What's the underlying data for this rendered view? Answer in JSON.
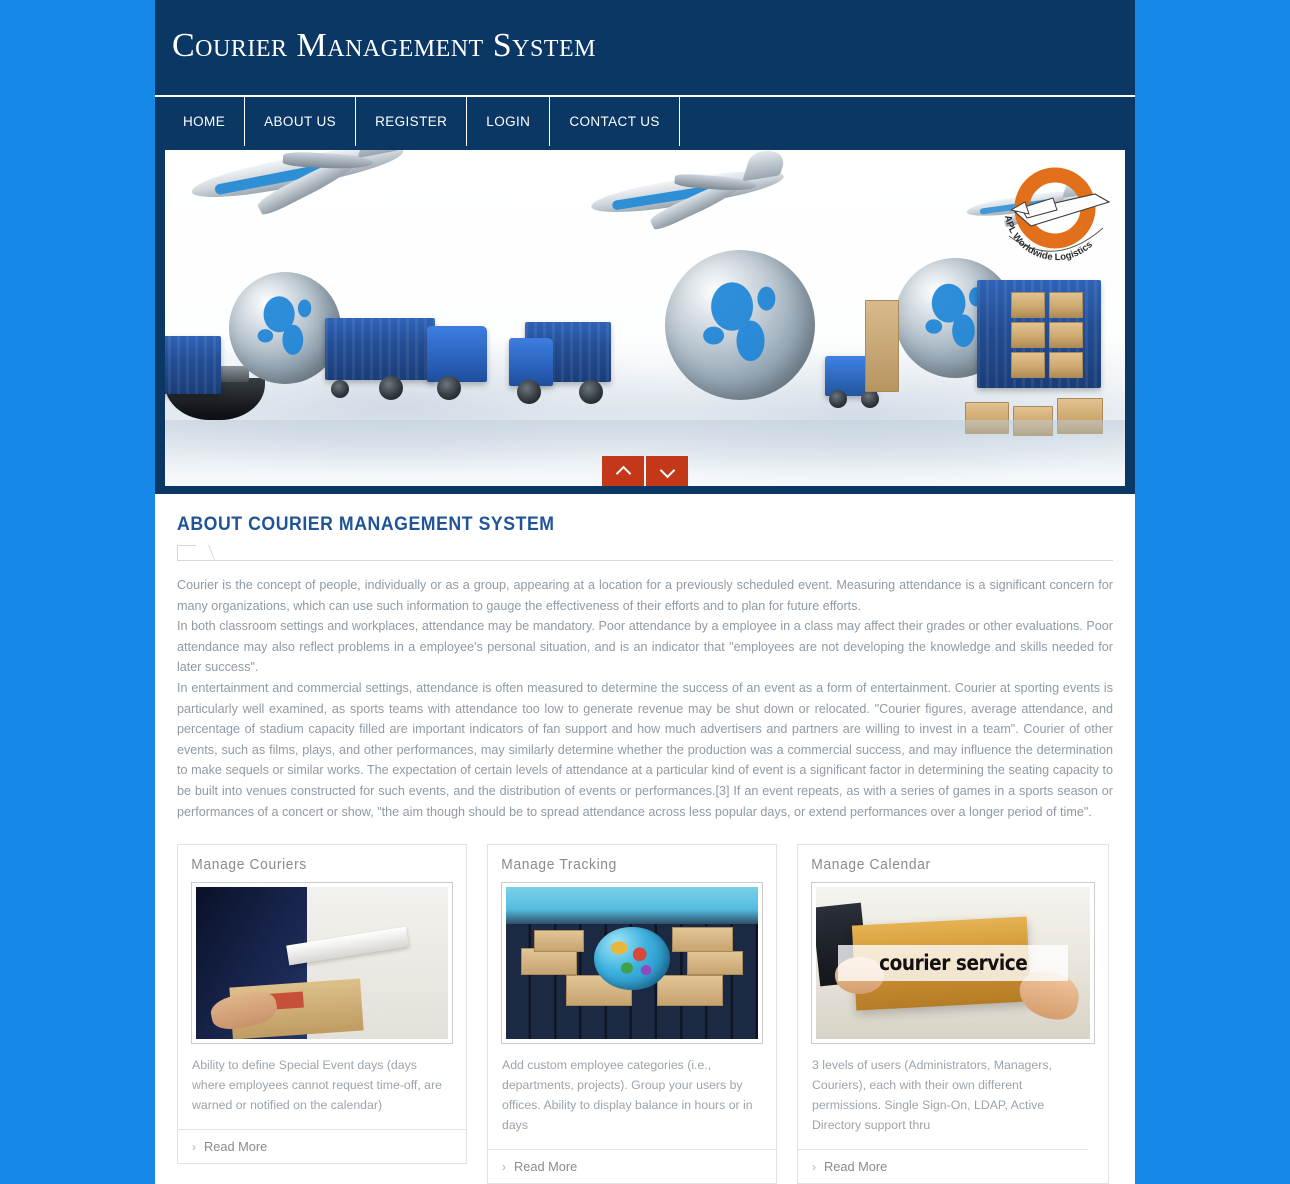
{
  "header": {
    "title": "Courier Management System"
  },
  "nav": {
    "items": [
      {
        "label": "HOME"
      },
      {
        "label": "ABOUT US"
      },
      {
        "label": "REGISTER"
      },
      {
        "label": "LOGIN"
      },
      {
        "label": "CONTACT US"
      }
    ]
  },
  "hero": {
    "logo_text": "APL Worldwide Logistics",
    "controls": {
      "prev": "prev-slide",
      "next": "next-slide"
    }
  },
  "about": {
    "title": "ABOUT COURIER MANAGEMENT SYSTEM",
    "paragraphs": [
      "Courier is the concept of people, individually or as a group, appearing at a location for a previously scheduled event. Measuring attendance is a significant concern for many organizations, which can use such information to gauge the effectiveness of their efforts and to plan for future efforts.",
      "In both classroom settings and workplaces, attendance may be mandatory. Poor attendance by a employee in a class may affect their grades or other evaluations. Poor attendance may also reflect problems in a employee's personal situation, and is an indicator that \"employees are not developing the knowledge and skills needed for later success\".",
      "In entertainment and commercial settings, attendance is often measured to determine the success of an event as a form of entertainment. Courier at sporting events is particularly well examined, as sports teams with attendance too low to generate revenue may be shut down or relocated. \"Courier figures, average attendance, and percentage of stadium capacity filled are important indicators of fan support and how much advertisers and partners are willing to invest in a team\". Courier of other events, such as films, plays, and other performances, may similarly determine whether the production was a commercial success, and may influence the determination to make sequels or similar works. The expectation of certain levels of attendance at a particular kind of event is a significant factor in determining the seating capacity to be built into venues constructed for such events, and the distribution of events or performances.[3] If an event repeats, as with a series of games in a sports season or performances of a concert or show, \"the aim though should be to spread attendance across less popular days, or extend performances over a longer period of time\"."
    ]
  },
  "cards": [
    {
      "title": "Manage Couriers",
      "image_alt": "courier-with-clipboard-and-parcel",
      "description": "Ability to define Special Event days (days where employees cannot request time-off, are warned or notified on the calendar)",
      "read_more": "Read More"
    },
    {
      "title": "Manage Tracking",
      "image_alt": "parcels-and-globe-on-laptop-keyboard",
      "description": "Add custom employee categories (i.e., departments, projects). Group your users by offices. Ability to display balance in hours or in days",
      "read_more": "Read More"
    },
    {
      "title": "Manage Calendar",
      "image_alt": "courier-service-parcel-handoff",
      "image_caption": "courier service",
      "description": "3 levels of users (Administrators, Managers, Couriers), each with their own different permissions. Single Sign-On, LDAP, Active Directory support thru",
      "read_more": "Read More"
    }
  ],
  "colors": {
    "page_background": "#1689e8",
    "header_navy": "#0b3765",
    "heading_blue": "#1f5499",
    "carousel_button": "#c4381a",
    "body_text": "#8e9aa5"
  }
}
